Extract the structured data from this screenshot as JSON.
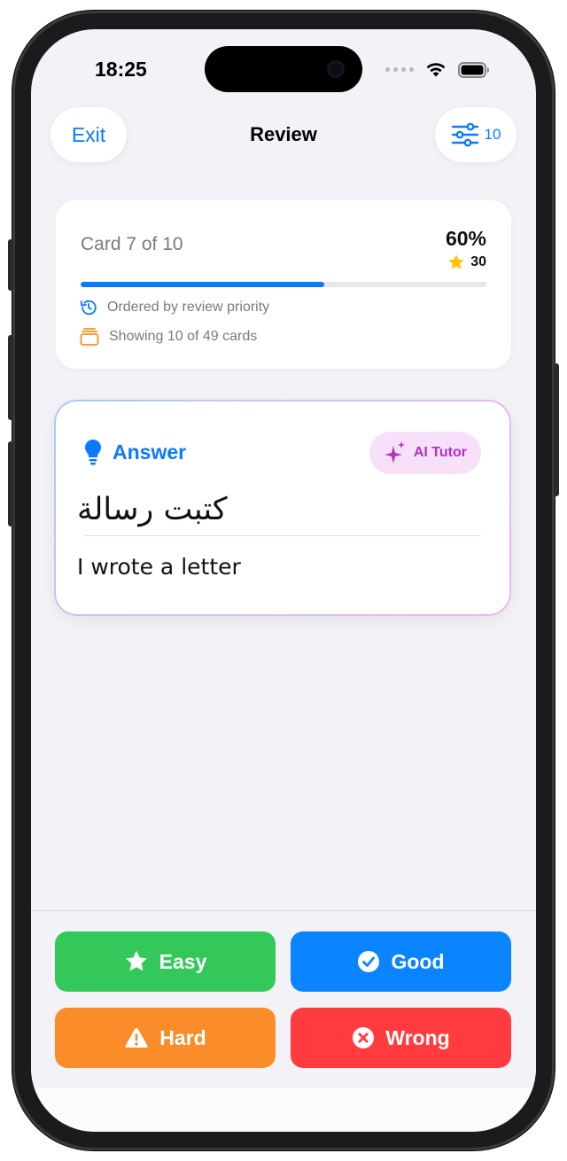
{
  "status_bar": {
    "time": "18:25"
  },
  "nav": {
    "exit_label": "Exit",
    "title": "Review",
    "filter_count": "10"
  },
  "progress": {
    "card_label": "Card 7 of 10",
    "percent_label": "60%",
    "score": "30",
    "fraction": 0.6,
    "order_text": "Ordered by review priority",
    "showing_text": "Showing 10 of 49 cards"
  },
  "answer": {
    "heading": "Answer",
    "ai_tutor_label": "AI Tutor",
    "arabic_text": "كتبت رسالة",
    "translation": "I wrote a letter"
  },
  "actions": {
    "easy": "Easy",
    "good": "Good",
    "hard": "Hard",
    "wrong": "Wrong"
  },
  "colors": {
    "accent": "#0a7aff",
    "easy": "#34c759",
    "good": "#0a84ff",
    "hard": "#fa8c2a",
    "wrong": "#ff3b40",
    "ai_tutor": "#b232c4"
  }
}
